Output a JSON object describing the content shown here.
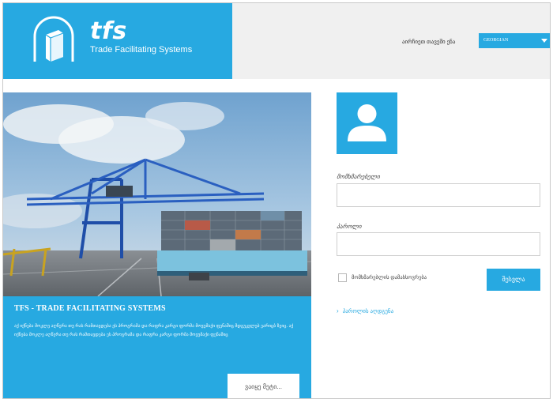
{
  "header": {
    "logo_title": "tfs",
    "logo_subtitle": "Trade Facilitating Systems",
    "language_label": "აირჩიეთ თავეში ენა",
    "language_value": "GEORGIAN"
  },
  "promo": {
    "title": "TFS - TRADE FACILITATING SYSTEMS",
    "description": "აქ იქნება მოკლე აღწერა თუ რას რამთავდება ეს პროგრამა და რაფრა კარგი ფორმა მოვუმაქი ფენაშიც მდგუკვლებ ეარიცბ ზეიც. აქ იქნება მოკლე აღწერა თუ რას რამთავდება ეს პროგრამა და რაფრა კარგი ფორმა მოვუმაქი ფენაშიც",
    "more_label": "ვაიყე მეტი..."
  },
  "login": {
    "username_label": "მომხმარებელი",
    "username_value": "",
    "password_label": "პაროლი",
    "password_value": "",
    "remember_label": "მომხმარებლის დამახსოვრება",
    "remember_checked": false,
    "submit_label": "შესვლა",
    "forgot_label": "პაროლის აღდგენა"
  },
  "colors": {
    "accent": "#27a9e1",
    "header_bg": "#f0f0f0",
    "border": "#cfcfcf"
  },
  "icons": {
    "logo": "box-logo-icon",
    "avatar": "user-silhouette-icon",
    "language_dropdown": "caret-down-icon",
    "forgot_link": "chevron-right-icon"
  }
}
